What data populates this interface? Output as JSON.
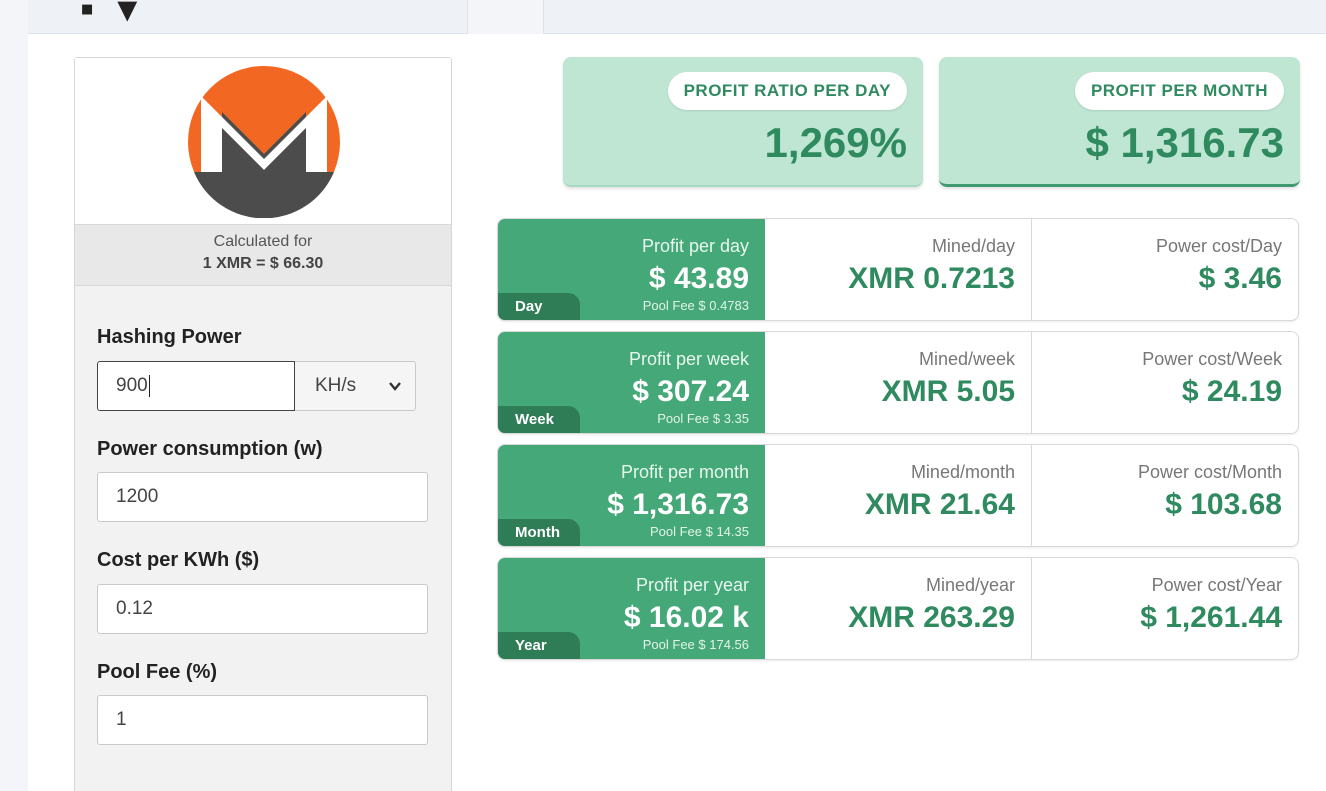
{
  "coin": {
    "logo_icon": "monero-logo-icon",
    "calculated_for_label": "Calculated for",
    "rate": "1 XMR = $ 66.30"
  },
  "form": {
    "hashing_power": {
      "label": "Hashing Power",
      "value": "900",
      "unit": "KH/s"
    },
    "power_consumption": {
      "label": "Power consumption (w)",
      "value": "1200"
    },
    "cost_per_kwh": {
      "label": "Cost per KWh ($)",
      "value": "0.12"
    },
    "pool_fee": {
      "label": "Pool Fee (%)",
      "value": "1"
    }
  },
  "summary": {
    "ratio": {
      "label": "PROFIT RATIO PER DAY",
      "value": "1,269%"
    },
    "month": {
      "label": "PROFIT PER MONTH",
      "value": "$ 1,316.73"
    }
  },
  "periods": [
    {
      "tag": "Day",
      "profit_label": "Profit per day",
      "profit": "$ 43.89",
      "pool_fee": "Pool Fee $ 0.4783",
      "mined_label": "Mined/day",
      "mined": "XMR 0.7213",
      "power_label": "Power cost/Day",
      "power": "$ 3.46"
    },
    {
      "tag": "Week",
      "profit_label": "Profit per week",
      "profit": "$ 307.24",
      "pool_fee": "Pool Fee $ 3.35",
      "mined_label": "Mined/week",
      "mined": "XMR 5.05",
      "power_label": "Power cost/Week",
      "power": "$ 24.19"
    },
    {
      "tag": "Month",
      "profit_label": "Profit per month",
      "profit": "$ 1,316.73",
      "pool_fee": "Pool Fee $ 14.35",
      "mined_label": "Mined/month",
      "mined": "XMR 21.64",
      "power_label": "Power cost/Month",
      "power": "$ 103.68"
    },
    {
      "tag": "Year",
      "profit_label": "Profit per year",
      "profit": "$ 16.02 k",
      "pool_fee": "Pool Fee $ 174.56",
      "mined_label": "Mined/year",
      "mined": "XMR 263.29",
      "power_label": "Power cost/Year",
      "power": "$ 1,261.44"
    }
  ],
  "colors": {
    "accent_green": "#44a878",
    "dark_green": "#2f7d57",
    "text_green": "#2f8a5f",
    "summary_bg": "#bfe5d3",
    "monero_orange": "#f26822",
    "monero_gray": "#4c4c4c"
  }
}
